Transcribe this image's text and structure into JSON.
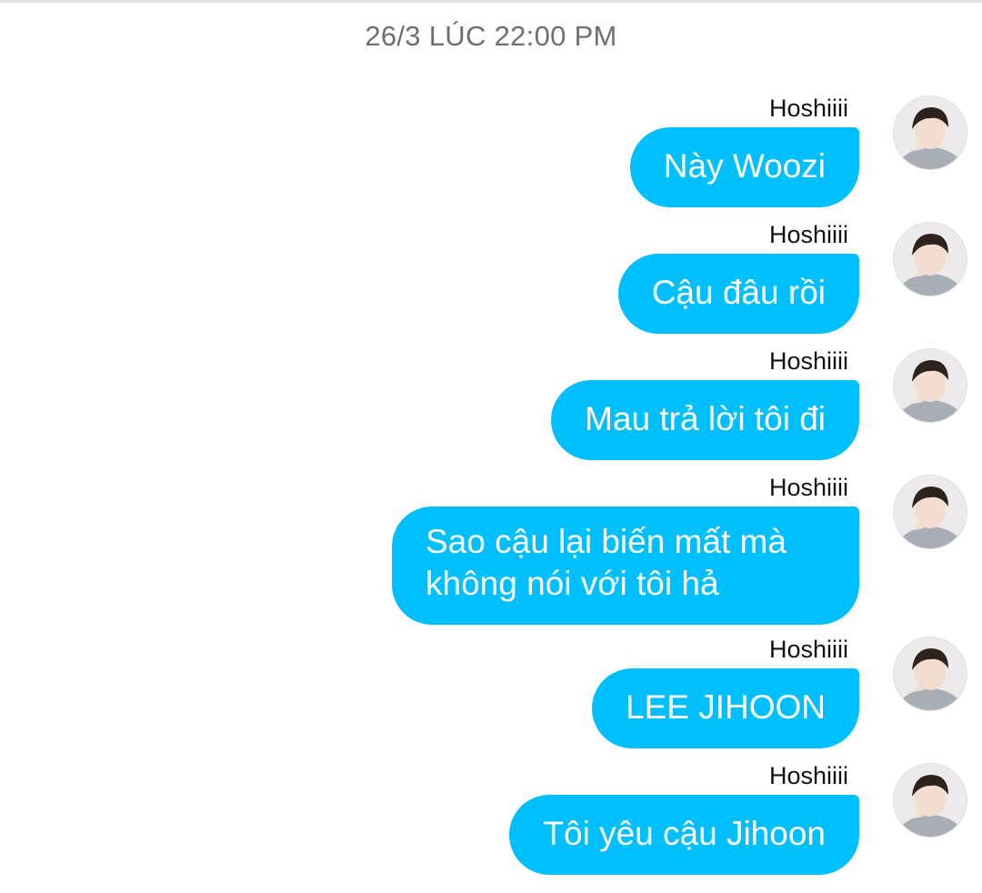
{
  "header": {
    "timestamp": "26/3 LÚC 22:00 PM"
  },
  "messages": [
    {
      "sender": "Hoshiiii",
      "text": "Này Woozi"
    },
    {
      "sender": "Hoshiiii",
      "text": "Cậu đâu rồi"
    },
    {
      "sender": "Hoshiiii",
      "text": "Mau trả lời tôi đi"
    },
    {
      "sender": "Hoshiiii",
      "text": "Sao cậu lại biến mất mà không nói với tôi hả"
    },
    {
      "sender": "Hoshiiii",
      "text": "LEE JIHOON"
    },
    {
      "sender": "Hoshiiii",
      "text": "Tôi yêu cậu Jihoon"
    }
  ],
  "theme": {
    "bubble_color": "#00bfff",
    "bubble_text_color": "#ffffff",
    "timestamp_color": "#6f6f6f"
  },
  "icons": {
    "avatar": "user-avatar-photo"
  }
}
